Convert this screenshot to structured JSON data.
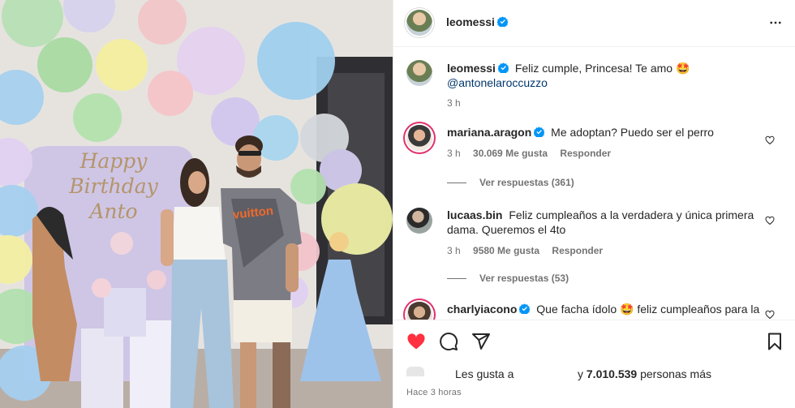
{
  "photo": {
    "backdrop_text": [
      "Happy",
      "Birthday",
      "Anto"
    ],
    "shirt_text": "vuitton"
  },
  "post": {
    "author": "leomessi",
    "more_icon": "more-horizontal-icon",
    "caption": {
      "username": "leomessi",
      "text": "Feliz cumple, Princesa! Te amo 🤩",
      "mention": "@antonelaroccuzzo",
      "time": "3 h"
    }
  },
  "comments": [
    {
      "username": "mariana.aragon",
      "verified": true,
      "text": "Me adoptan? Puedo ser el perro",
      "time": "3 h",
      "likes": "30.069 Me gusta",
      "reply": "Responder",
      "view_replies": "Ver respuestas (361)"
    },
    {
      "username": "lucaas.bin",
      "verified": false,
      "text": "Feliz cumpleaños a la verdadera y única primera dama. Queremos el 4to",
      "time": "3 h",
      "likes": "9580 Me gusta",
      "reply": "Responder",
      "view_replies": "Ver respuestas (53)"
    },
    {
      "username": "charlyiacono",
      "verified": true,
      "text": "Que facha ídolo 🤩 feliz cumpleaños para la"
    }
  ],
  "actions": {
    "like_icon": "heart-filled-icon",
    "comment_icon": "comment-icon",
    "share_icon": "send-icon",
    "save_icon": "bookmark-icon",
    "like_color": "#ff3040"
  },
  "likes": {
    "prefix": "Les gusta a",
    "count": "7.010.539",
    "suffix_rest": "personas más"
  },
  "time_ago": "Hace 3 horas",
  "colors": {
    "verified": "#0095f6",
    "muted": "#737373",
    "mention": "#00376b"
  }
}
